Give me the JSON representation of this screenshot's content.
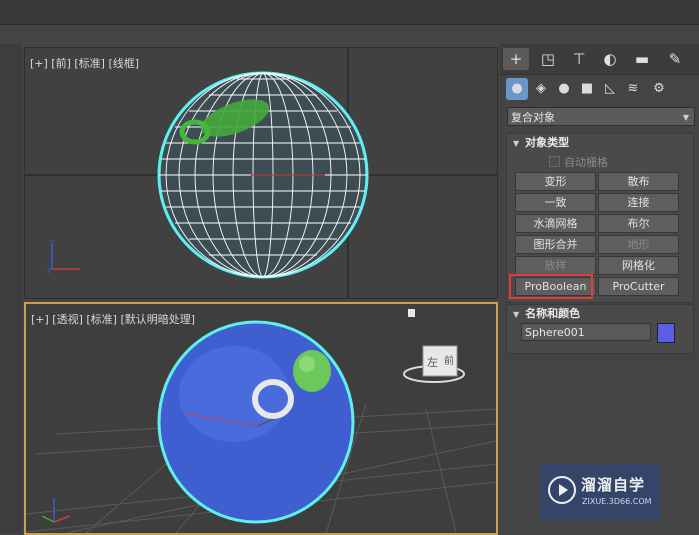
{
  "viewports": {
    "top": {
      "label": "[+] [前] [标准] [线框]"
    },
    "perspective": {
      "label": "[+] [透视] [标准] [默认明暗处理]"
    }
  },
  "command_panel": {
    "tabs": [
      {
        "icon": "create-icon",
        "glyph": "+"
      },
      {
        "icon": "modify-icon",
        "glyph": "◳"
      },
      {
        "icon": "hierarchy-icon",
        "glyph": "⊤"
      },
      {
        "icon": "motion-icon",
        "glyph": "◐"
      },
      {
        "icon": "display-icon",
        "glyph": "▬"
      },
      {
        "icon": "utilities-icon",
        "glyph": "✎"
      }
    ],
    "categories": [
      {
        "icon": "geometry-icon",
        "glyph": "●"
      },
      {
        "icon": "shapes-icon",
        "glyph": "◈"
      },
      {
        "icon": "lights-icon",
        "glyph": "●"
      },
      {
        "icon": "cameras-icon",
        "glyph": "■"
      },
      {
        "icon": "helpers-icon",
        "glyph": "◺"
      },
      {
        "icon": "spacewarps-icon",
        "glyph": "≋"
      },
      {
        "icon": "systems-icon",
        "glyph": "⚙"
      }
    ],
    "dropdown": {
      "value": "复合对象"
    },
    "object_type": {
      "title": "对象类型",
      "autogrid_label": "自动栅格",
      "buttons": [
        {
          "label": "变形",
          "enabled": true
        },
        {
          "label": "散布",
          "enabled": true
        },
        {
          "label": "一致",
          "enabled": true
        },
        {
          "label": "连接",
          "enabled": true
        },
        {
          "label": "水滴网格",
          "enabled": true
        },
        {
          "label": "布尔",
          "enabled": true
        },
        {
          "label": "图形合并",
          "enabled": true
        },
        {
          "label": "地形",
          "enabled": false
        },
        {
          "label": "放样",
          "enabled": false
        },
        {
          "label": "网格化",
          "enabled": true
        },
        {
          "label": "ProBoolean",
          "enabled": true
        },
        {
          "label": "ProCutter",
          "enabled": true
        }
      ]
    },
    "name_color": {
      "title": "名称和颜色",
      "name": "Sphere001",
      "color": "#5c5ee6"
    }
  },
  "watermark": {
    "text": "溜溜自学",
    "url": "ZIXUE.3D66.COM"
  },
  "colors": {
    "selection_cyan": "#5ef0f0",
    "sphere_blue": "#3f5fd0",
    "highlight_red": "#e03c3c",
    "viewport_active": "#c9a14a"
  }
}
